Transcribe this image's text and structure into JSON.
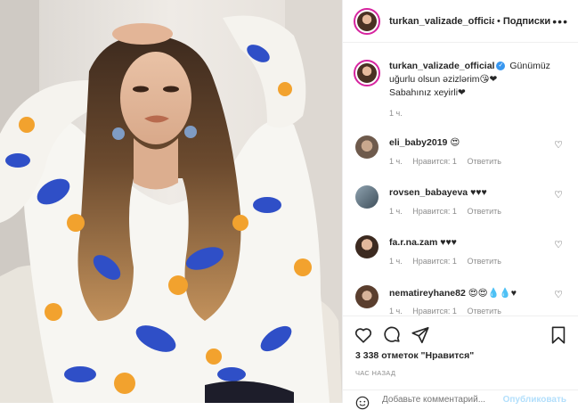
{
  "post": {
    "author": "turkan_valizade_official",
    "follow_label": "Подписки",
    "separator": "•",
    "more_icon": "more-horizontal-icon",
    "caption": {
      "username": "turkan_valizade_official",
      "verified_icon": "verified-badge-icon",
      "text_line1": "Günümüz",
      "text_line2": "uğurlu olsun əzizlərim😘❤",
      "text_line3": "Sabahınız xeyirli❤",
      "time": "1 ч."
    },
    "comments": [
      {
        "username": "eli_baby2019",
        "text": "😍",
        "time": "1 ч.",
        "likes": "Нравится: 1",
        "reply": "Ответить"
      },
      {
        "username": "rovsen_babayeva",
        "text": "♥♥♥",
        "time": "1 ч.",
        "likes": "Нравится: 1",
        "reply": "Ответить"
      },
      {
        "username": "fa.r.na.zam",
        "text": "♥♥♥",
        "time": "1 ч.",
        "likes": "Нравится: 1",
        "reply": "Ответить"
      },
      {
        "username": "nematireyhane82",
        "text": "😍😍💧💧♥",
        "time": "1 ч.",
        "likes": "Нравится: 1",
        "reply": "Ответить"
      }
    ],
    "likes_text": "3 338 отметок \"Нравится\"",
    "posted_ago": "час назад",
    "comment_placeholder": "Добавьте комментарий...",
    "publish_label": "Опубликовать",
    "colors": {
      "link": "#3897f0",
      "publish_disabled": "#b2dffc",
      "muted": "#8e8e8e",
      "text": "#262626",
      "story_ring": "#d6249f"
    },
    "icons": [
      "heart-icon",
      "comment-icon",
      "share-icon",
      "bookmark-icon",
      "emoji-icon",
      "comment-like-heart-icon"
    ]
  }
}
